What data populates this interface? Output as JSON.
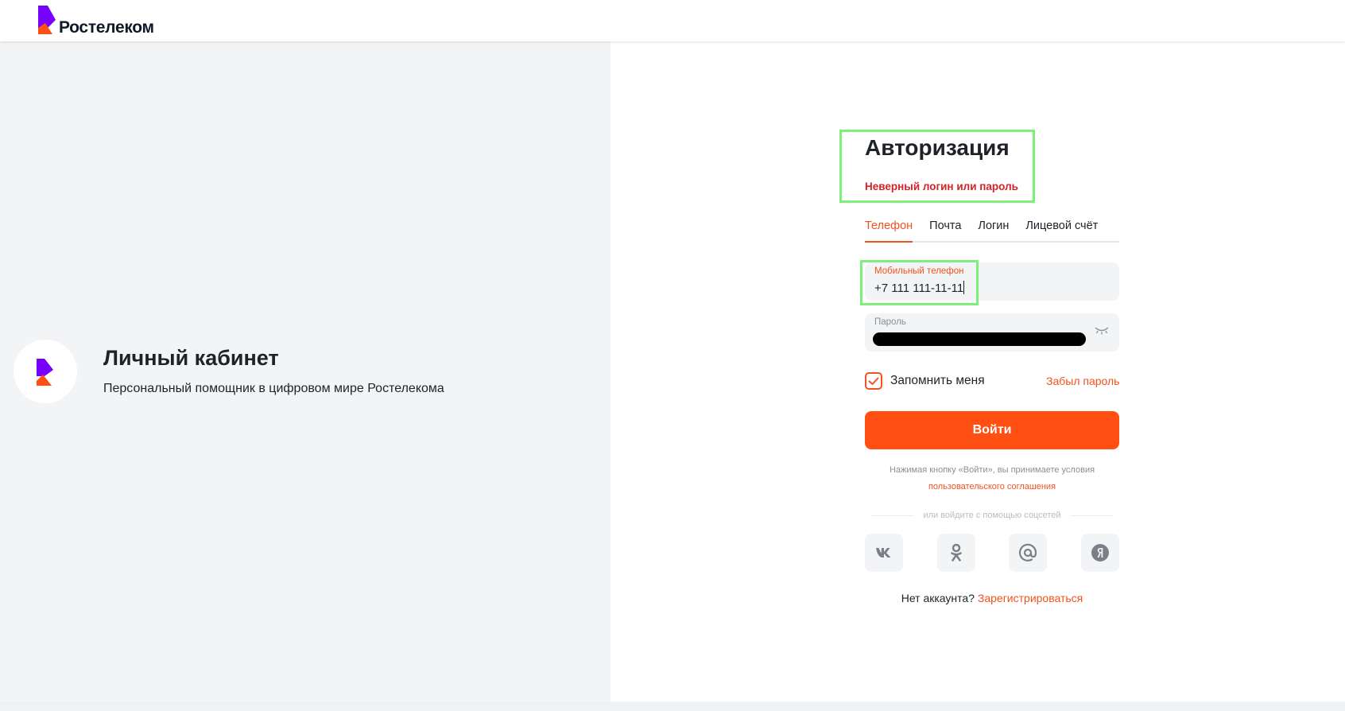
{
  "header": {
    "brand": "Ростелеком"
  },
  "promo": {
    "title": "Личный кабинет",
    "subtitle": "Персональный помощник в цифровом мире Ростелекома"
  },
  "form": {
    "title": "Авторизация",
    "error": "Неверный логин или пароль",
    "tabs": [
      {
        "label": "Телефон",
        "active": true
      },
      {
        "label": "Почта",
        "active": false
      },
      {
        "label": "Логин",
        "active": false
      },
      {
        "label": "Лицевой счёт",
        "active": false
      }
    ],
    "phone": {
      "label": "Мобильный телефон",
      "value": "+7 111 111-11-11"
    },
    "password": {
      "label": "Пароль"
    },
    "remember_label": "Запомнить меня",
    "remember_checked": true,
    "forgot_label": "Забыл пароль",
    "submit_label": "Войти",
    "terms_text": "Нажимая кнопку «Войти», вы принимаете условия",
    "terms_link": "пользовательского соглашения",
    "social_divider": "или войдите с помощью соцсетей",
    "socials": [
      "vk-icon",
      "ok-icon",
      "mail-icon",
      "yandex-icon"
    ],
    "no_account": "Нет аккаунта?",
    "register_link": "Зарегистрироваться"
  },
  "colors": {
    "accent": "#ff4f12",
    "accent_text": "#f4511e",
    "error": "#d3222c",
    "brand_purple": "#7700ff",
    "annotation_box": "#7ef07a"
  }
}
